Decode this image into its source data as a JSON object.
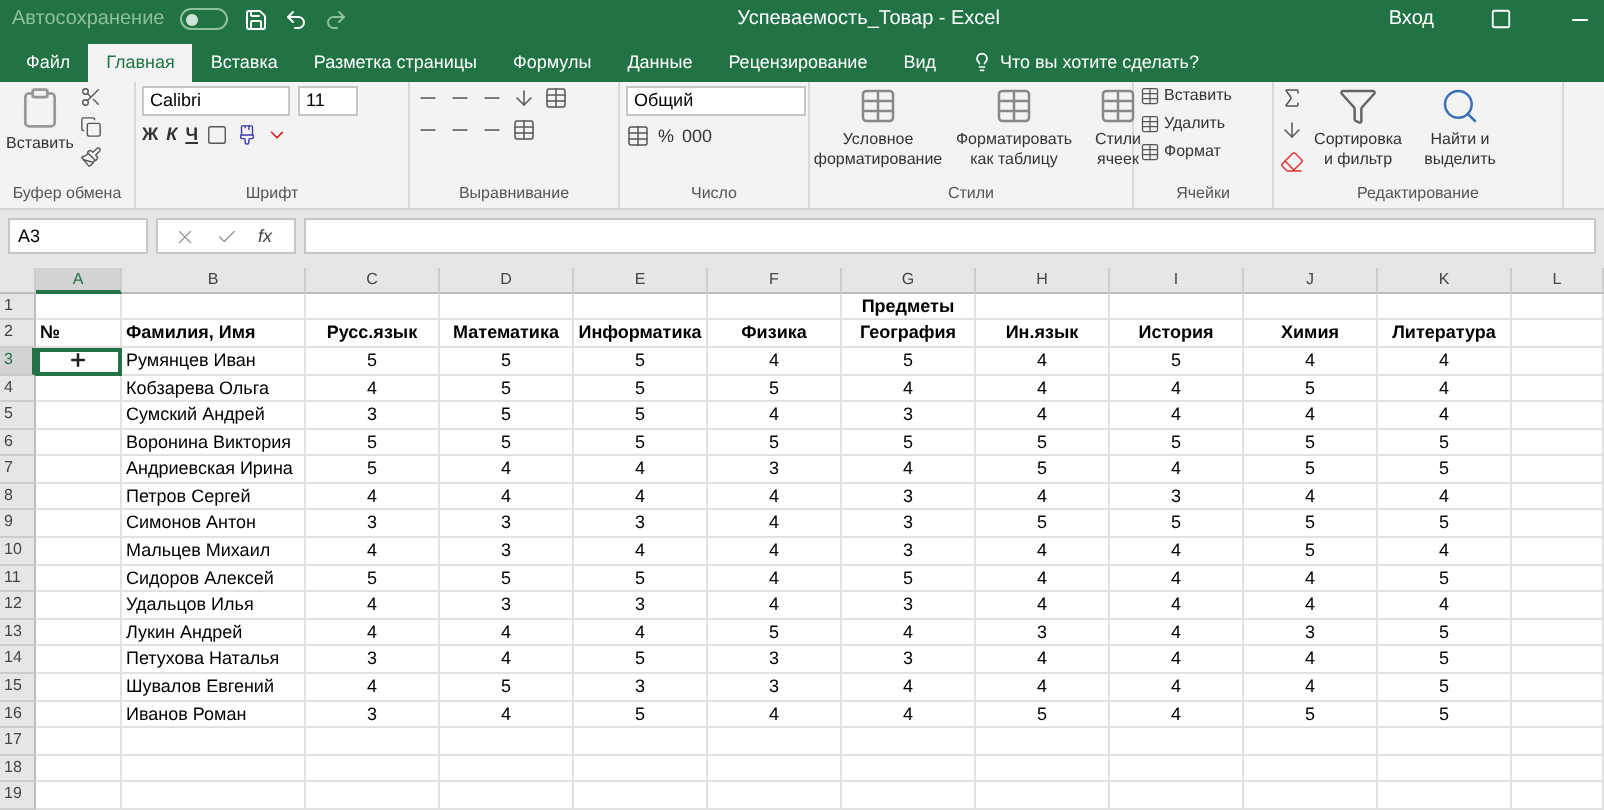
{
  "title_bar": {
    "autosave_label": "Автосохранение",
    "autosave_on": false,
    "title": "Успеваемость_Товар  -  Excel",
    "sign_in": "Вход"
  },
  "tabs": [
    {
      "label": "Файл",
      "selected": false
    },
    {
      "label": "Главная",
      "selected": true
    },
    {
      "label": "Вставка",
      "selected": false
    },
    {
      "label": "Разметка страницы",
      "selected": false
    },
    {
      "label": "Формулы",
      "selected": false
    },
    {
      "label": "Данные",
      "selected": false
    },
    {
      "label": "Рецензирование",
      "selected": false
    },
    {
      "label": "Вид",
      "selected": false
    }
  ],
  "tell_me": "Что вы хотите сделать?",
  "ribbon": [
    {
      "kind": "clipboard",
      "label": "Буфер обмена",
      "paste": "Вставить"
    },
    {
      "kind": "font",
      "label": "Шрифт",
      "font_name": "Calibri",
      "font_size": "11",
      "bold": "Ж",
      "italic": "К",
      "underline": "Ч"
    },
    {
      "kind": "alignment",
      "label": "Выравнивание"
    },
    {
      "kind": "number",
      "label": "Число",
      "format": "Общий",
      "percent": "%",
      "thousands": "000"
    },
    {
      "kind": "styles",
      "label": "Стили",
      "buttons": [
        "Условное форматирование",
        "Форматировать как таблицу",
        "Стили ячеек"
      ]
    },
    {
      "kind": "cells",
      "label": "Ячейки",
      "buttons": [
        "Вставить",
        "Удалить",
        "Формат"
      ]
    },
    {
      "kind": "editing",
      "label": "Редактирование",
      "buttons": [
        "Сортировка и фильтр",
        "Найти и выделить"
      ]
    }
  ],
  "formula_bar": {
    "name_box": "A3",
    "function_label": "fx"
  },
  "sheet": {
    "columns": [
      {
        "label": "A",
        "selected": true
      },
      {
        "label": "B",
        "selected": false
      },
      {
        "label": "C",
        "selected": false
      },
      {
        "label": "D",
        "selected": false
      },
      {
        "label": "E",
        "selected": false
      },
      {
        "label": "F",
        "selected": false
      },
      {
        "label": "G",
        "selected": false
      },
      {
        "label": "H",
        "selected": false
      },
      {
        "label": "I",
        "selected": false
      },
      {
        "label": "J",
        "selected": false
      },
      {
        "label": "K",
        "selected": false
      },
      {
        "label": "L",
        "selected": false
      }
    ],
    "rows": [
      {
        "kind": "title",
        "number": "1",
        "selected": false,
        "title": "Предметы"
      },
      {
        "kind": "header",
        "number": "2",
        "selected": false,
        "no": "№",
        "name": "Фамилия, Имя",
        "subjects": [
          "Русс.язык",
          "Математика",
          "Информатика",
          "Физика",
          "География",
          "Ин.язык",
          "История",
          "Химия",
          "Литература"
        ]
      },
      {
        "kind": "student",
        "number": "3",
        "selected": true,
        "name": "Румянцев Иван",
        "grades": [
          "5",
          "5",
          "5",
          "4",
          "5",
          "4",
          "5",
          "4",
          "4"
        ]
      },
      {
        "kind": "student",
        "number": "4",
        "selected": false,
        "name": "Кобзарева Ольга",
        "grades": [
          "4",
          "5",
          "5",
          "5",
          "4",
          "4",
          "4",
          "5",
          "4"
        ]
      },
      {
        "kind": "student",
        "number": "5",
        "selected": false,
        "name": "Сумский Андрей",
        "grades": [
          "3",
          "5",
          "5",
          "4",
          "3",
          "4",
          "4",
          "4",
          "4"
        ]
      },
      {
        "kind": "student",
        "number": "6",
        "selected": false,
        "name": "Воронина Виктория",
        "grades": [
          "5",
          "5",
          "5",
          "5",
          "5",
          "5",
          "5",
          "5",
          "5"
        ]
      },
      {
        "kind": "student",
        "number": "7",
        "selected": false,
        "name": "Андриевская Ирина",
        "grades": [
          "5",
          "4",
          "4",
          "3",
          "4",
          "5",
          "4",
          "5",
          "5"
        ]
      },
      {
        "kind": "student",
        "number": "8",
        "selected": false,
        "name": "Петров Сергей",
        "grades": [
          "4",
          "4",
          "4",
          "4",
          "3",
          "4",
          "3",
          "4",
          "4"
        ]
      },
      {
        "kind": "student",
        "number": "9",
        "selected": false,
        "name": "Симонов Антон",
        "grades": [
          "3",
          "3",
          "3",
          "4",
          "3",
          "5",
          "5",
          "5",
          "5"
        ]
      },
      {
        "kind": "student",
        "number": "10",
        "selected": false,
        "name": "Мальцев Михаил",
        "grades": [
          "4",
          "3",
          "4",
          "4",
          "3",
          "4",
          "4",
          "5",
          "4"
        ]
      },
      {
        "kind": "student",
        "number": "11",
        "selected": false,
        "name": "Сидоров Алексей",
        "grades": [
          "5",
          "5",
          "5",
          "4",
          "5",
          "4",
          "4",
          "4",
          "5"
        ]
      },
      {
        "kind": "student",
        "number": "12",
        "selected": false,
        "name": "Удальцов Илья",
        "grades": [
          "4",
          "3",
          "3",
          "4",
          "3",
          "4",
          "4",
          "4",
          "4"
        ]
      },
      {
        "kind": "student",
        "number": "13",
        "selected": false,
        "name": "Лукин Андрей",
        "grades": [
          "4",
          "4",
          "4",
          "5",
          "4",
          "3",
          "4",
          "3",
          "5"
        ]
      },
      {
        "kind": "student",
        "number": "14",
        "selected": false,
        "name": "Петухова Наталья",
        "grades": [
          "3",
          "4",
          "5",
          "3",
          "3",
          "4",
          "4",
          "4",
          "5"
        ]
      },
      {
        "kind": "student",
        "number": "15",
        "selected": false,
        "name": "Шувалов Евгений",
        "grades": [
          "4",
          "5",
          "3",
          "3",
          "4",
          "4",
          "4",
          "4",
          "5"
        ]
      },
      {
        "kind": "student",
        "number": "16",
        "selected": false,
        "name": "Иванов Роман",
        "grades": [
          "3",
          "4",
          "5",
          "4",
          "4",
          "5",
          "4",
          "5",
          "5"
        ]
      },
      {
        "kind": "empty",
        "number": "17",
        "selected": false
      },
      {
        "kind": "empty",
        "number": "18",
        "selected": false
      },
      {
        "kind": "empty",
        "number": "19",
        "selected": false
      }
    ]
  }
}
